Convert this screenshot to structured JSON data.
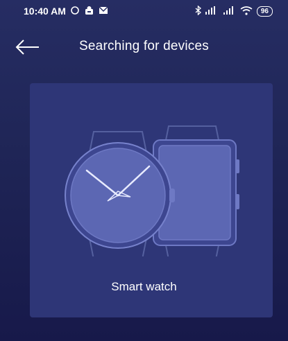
{
  "status_bar": {
    "time": "10:40 AM",
    "battery": "96"
  },
  "header": {
    "title": "Searching for devices"
  },
  "device_card": {
    "label": "Smart watch"
  },
  "colors": {
    "background": "#1f2556",
    "card": "#2e3677",
    "watch_face": "#5c67b3"
  }
}
